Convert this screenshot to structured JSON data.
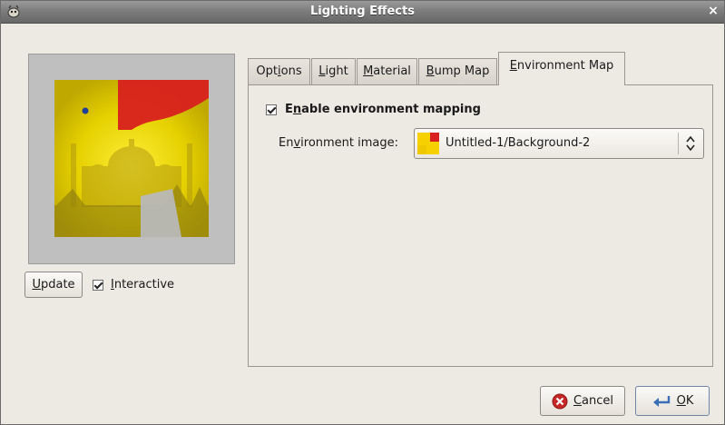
{
  "window": {
    "title": "Lighting Effects",
    "close_glyph": "×",
    "app_icon": "gimp-wilber-icon"
  },
  "preview": {
    "update_label_mn": "U",
    "update_label_rest": "pdate",
    "interactive_label_mn": "I",
    "interactive_label_rest": "nteractive",
    "interactive_checked": true
  },
  "tabs": [
    {
      "mn": "",
      "pre": "Opt",
      "mnc": "i",
      "post": "ons",
      "active": false
    },
    {
      "pre": "",
      "mnc": "L",
      "post": "ight",
      "active": false
    },
    {
      "pre": "",
      "mnc": "M",
      "post": "aterial",
      "active": false
    },
    {
      "pre": "",
      "mnc": "B",
      "post": "ump Map",
      "active": false
    },
    {
      "pre": "",
      "mnc": "E",
      "post": "nvironment Map",
      "active": true
    }
  ],
  "environment": {
    "enable_label_pre": "E",
    "enable_label_mn": "n",
    "enable_label_post": "able environment mapping",
    "enable_checked": true,
    "image_label_pre": "En",
    "image_label_mn": "v",
    "image_label_post": "ironment image:",
    "image_value": "Untitled-1/Background-2"
  },
  "buttons": {
    "cancel_mn": "C",
    "cancel_rest": "ancel",
    "ok_mn": "O",
    "ok_rest": "K"
  },
  "colors": {
    "accent_yellow": "#f7e000",
    "accent_red": "#d8201e",
    "cancel_red": "#c62828",
    "ok_blue": "#3a6fb8"
  }
}
